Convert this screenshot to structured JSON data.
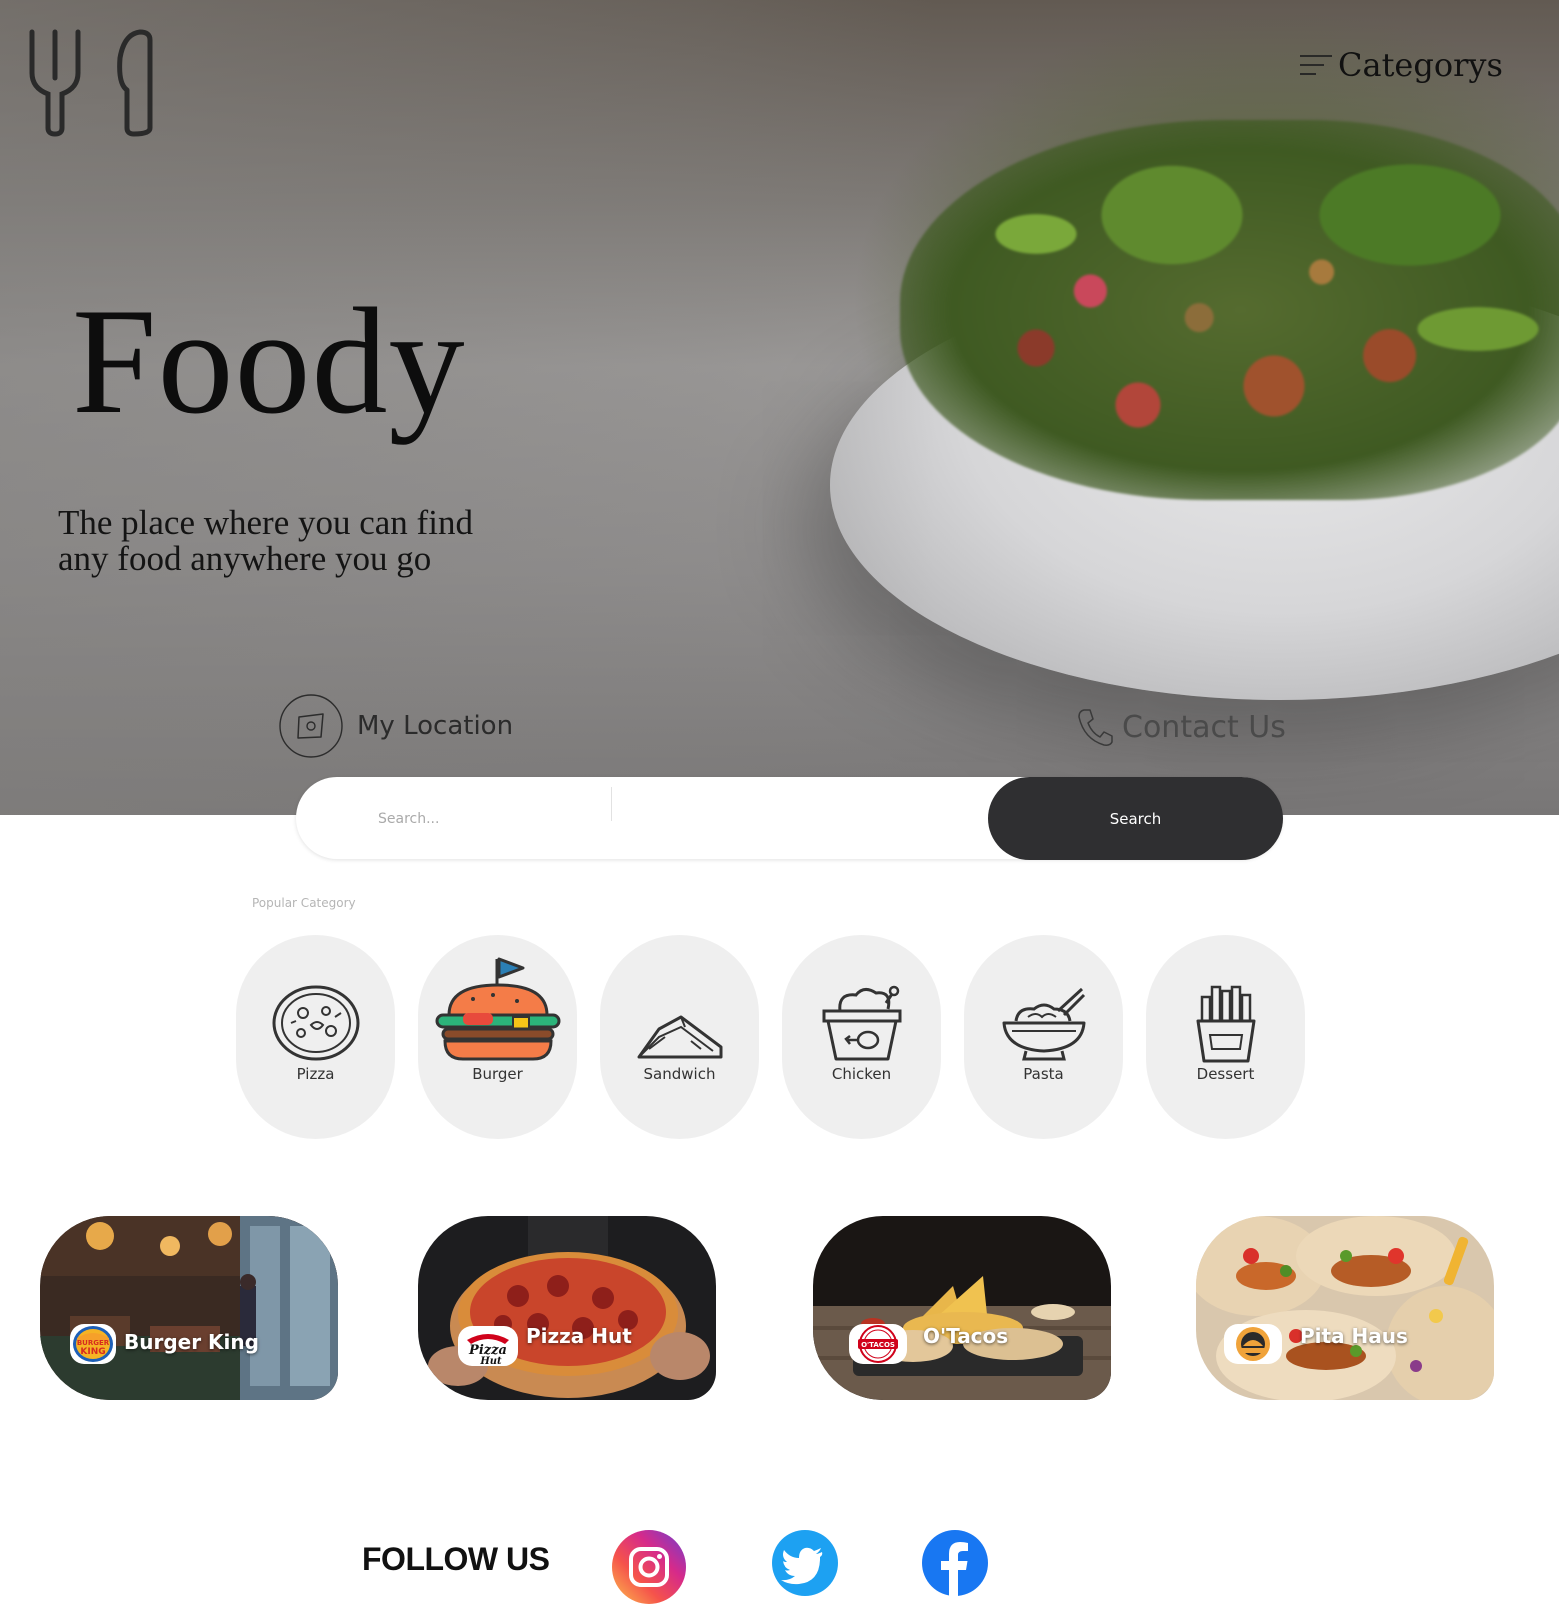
{
  "header": {
    "menu_label": "Categorys"
  },
  "hero": {
    "brand": "Foody",
    "tagline_line1": "The place where you can find",
    "tagline_line2": "any food anywhere you go",
    "location_label": "My Location",
    "contact_label": "Contact Us"
  },
  "search": {
    "placeholder": "Search...",
    "button_label": "Search"
  },
  "categories": {
    "heading": "Popular Category",
    "items": [
      {
        "label": "Pizza",
        "icon": "pizza-icon"
      },
      {
        "label": "Burger",
        "icon": "burger-icon"
      },
      {
        "label": "Sandwich",
        "icon": "sandwich-icon"
      },
      {
        "label": "Chicken",
        "icon": "chicken-icon"
      },
      {
        "label": "Pasta",
        "icon": "pasta-icon"
      },
      {
        "label": "Dessert",
        "icon": "fries-icon"
      }
    ]
  },
  "restaurants": [
    {
      "name": "Burger King",
      "logo_text": "BURGER KING"
    },
    {
      "name": "Pizza Hut",
      "logo_text": "Pizza Hut"
    },
    {
      "name": "O'Tacos",
      "logo_text": "O'TACOS"
    },
    {
      "name": "Pita Haus",
      "logo_text": "PITA HAUS"
    }
  ],
  "footer": {
    "follow_label": "FOLLOW US",
    "social": [
      "instagram-icon",
      "twitter-icon",
      "facebook-icon"
    ]
  },
  "colors": {
    "search_button": "#2f2f31",
    "category_bg": "#efefef",
    "burger_accent": "#f47c48",
    "facebook_blue": "#1877f2",
    "twitter_blue": "#1da1f2"
  }
}
